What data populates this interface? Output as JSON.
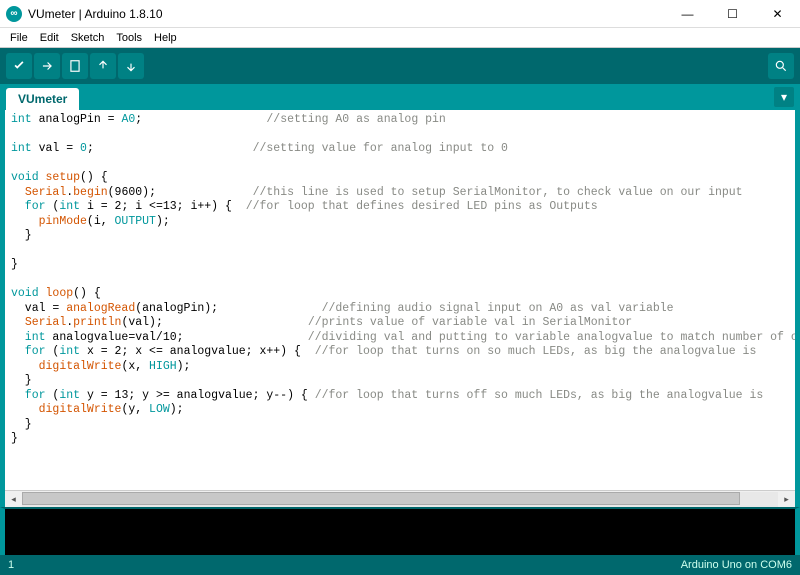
{
  "window": {
    "title": "VUmeter | Arduino 1.8.10"
  },
  "menu": {
    "file": "File",
    "edit": "Edit",
    "sketch": "Sketch",
    "tools": "Tools",
    "help": "Help"
  },
  "tabs": {
    "active": "VUmeter"
  },
  "status": {
    "left": "1",
    "right": "Arduino Uno on COM6"
  },
  "code": {
    "l1_a": "int",
    "l1_b": " analogPin = ",
    "l1_c": "A0",
    "l1_d": ";",
    "l1_cm": "//setting A0 as analog pin",
    "l3_a": "int",
    "l3_b": " val = ",
    "l3_c": "0",
    "l3_d": ";",
    "l3_cm": "//setting value for analog input to 0",
    "l5_a": "void",
    "l5_b": " setup",
    "l5_c": "() {",
    "l6_a": "  ",
    "l6_b": "Serial",
    "l6_c": ".",
    "l6_d": "begin",
    "l6_e": "(9600);",
    "l6_cm": "//this line is used to setup SerialMonitor, to check value on our input",
    "l7_a": "  for",
    "l7_b": " (",
    "l7_c": "int",
    "l7_d": " i = 2; i <=13; i++) {  ",
    "l7_cm": "//for loop that defines desired LED pins as Outputs",
    "l8_a": "    ",
    "l8_b": "pinMode",
    "l8_c": "(i, ",
    "l8_d": "OUTPUT",
    "l8_e": ");",
    "l9": "  }",
    "l11": "}",
    "l13_a": "void",
    "l13_b": " loop",
    "l13_c": "() {",
    "l14_a": "  val = ",
    "l14_b": "analogRead",
    "l14_c": "(analogPin);",
    "l14_cm": "//defining audio signal input on A0 as val variable",
    "l15_a": "  ",
    "l15_b": "Serial",
    "l15_c": ".",
    "l15_d": "println",
    "l15_e": "(val);",
    "l15_cm": "//prints value of variable val in SerialMonitor",
    "l16_a": "  int",
    "l16_b": " analogvalue=val/10;",
    "l16_cm": "//dividing val and putting to variable analogvalue to match number of our",
    "l17_a": "  for",
    "l17_b": " (",
    "l17_c": "int",
    "l17_d": " x = 2; x <= analogvalue; x++) {  ",
    "l17_cm": "//for loop that turns on so much LEDs, as big the analogvalue is",
    "l18_a": "    ",
    "l18_b": "digitalWrite",
    "l18_c": "(x, ",
    "l18_d": "HIGH",
    "l18_e": ");",
    "l19": "  }",
    "l20_a": "  for",
    "l20_b": " (",
    "l20_c": "int",
    "l20_d": " y = 13; y >= analogvalue; y--) { ",
    "l20_cm": "//for loop that turns off so much LEDs, as big the analogvalue is",
    "l21_a": "    ",
    "l21_b": "digitalWrite",
    "l21_c": "(y, ",
    "l21_d": "LOW",
    "l21_e": ");",
    "l22": "  }",
    "l23": "}"
  }
}
